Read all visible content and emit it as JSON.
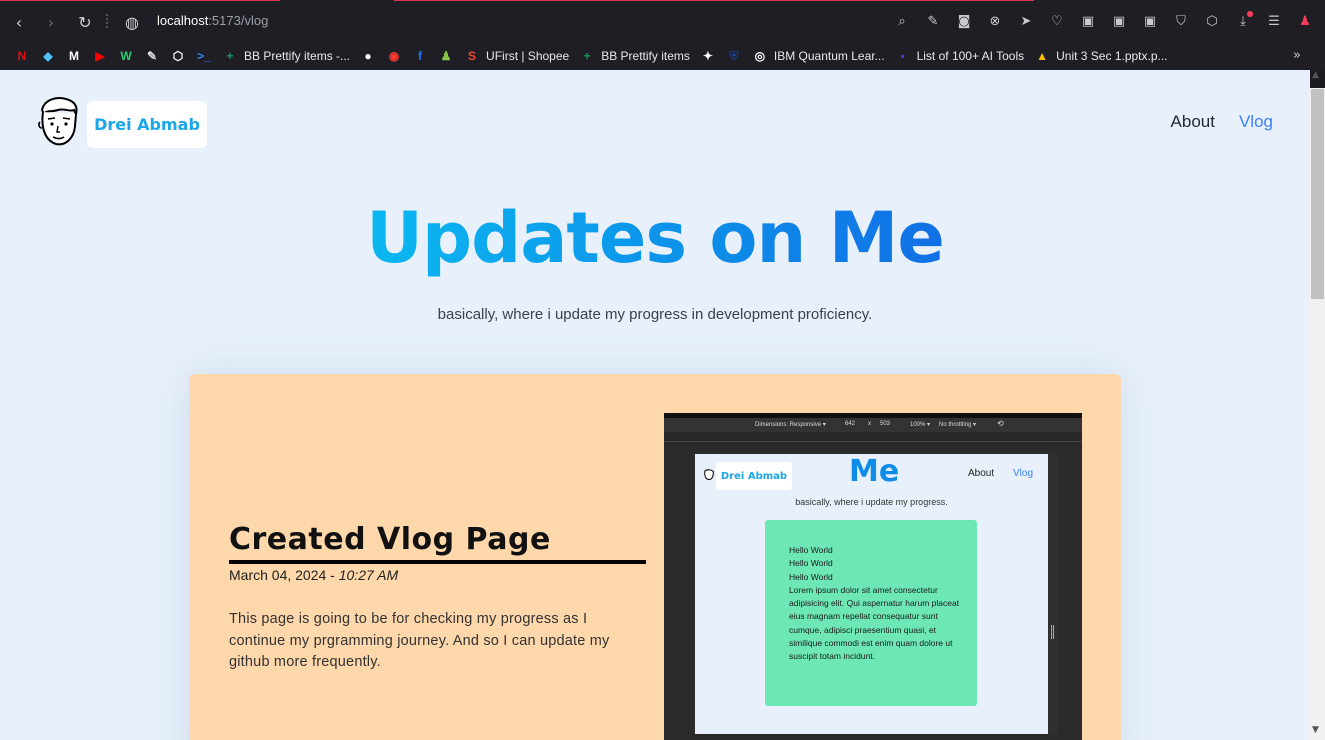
{
  "browser": {
    "url_host": "localhost",
    "url_path": ":5173/vlog",
    "toolbar_icons": [
      "zoom-icon",
      "edit-icon",
      "camera-icon",
      "block-icon",
      "send-icon",
      "heart-icon",
      "extension-icon",
      "extension-icon",
      "extension-icon",
      "shield-icon",
      "cube-icon",
      "download-icon",
      "menu-icon",
      "profile-icon"
    ],
    "bookmarks": [
      {
        "label": "",
        "color": "#e50914",
        "glyph": "N"
      },
      {
        "label": "",
        "color": "#4fc3f7",
        "glyph": "◆"
      },
      {
        "label": "",
        "color": "#ffffff",
        "glyph": "M"
      },
      {
        "label": "",
        "color": "#ff0000",
        "glyph": "▶"
      },
      {
        "label": "",
        "color": "#2ecc71",
        "glyph": "W"
      },
      {
        "label": "",
        "color": "#dddddd",
        "glyph": "✎"
      },
      {
        "label": "",
        "color": "#ffffff",
        "glyph": "⬡"
      },
      {
        "label": "",
        "color": "#3b82f6",
        "glyph": ">_"
      },
      {
        "label": "BB Prettify items -...",
        "color": "#0f9d58",
        "glyph": "+"
      },
      {
        "label": "",
        "color": "#ffffff",
        "glyph": "●"
      },
      {
        "label": "",
        "color": "#ff3b30",
        "glyph": "◉"
      },
      {
        "label": "",
        "color": "#1877f2",
        "glyph": "f"
      },
      {
        "label": "",
        "color": "#8bc34a",
        "glyph": "♟"
      },
      {
        "label": "UFirst | Shopee",
        "color": "#ee4d2d",
        "glyph": "S"
      },
      {
        "label": "BB Prettify items",
        "color": "#0f9d58",
        "glyph": "+"
      },
      {
        "label": "",
        "color": "#ffffff",
        "glyph": "✦"
      },
      {
        "label": "",
        "color": "#1e3a8a",
        "glyph": "⛨"
      },
      {
        "label": "IBM Quantum Lear...",
        "color": "#ffffff",
        "glyph": "◎"
      },
      {
        "label": "List of 100+ AI Tools",
        "color": "#6d28d9",
        "glyph": "▪"
      },
      {
        "label": "Unit 3 Sec 1.pptx.p...",
        "color": "#fbbc04",
        "glyph": "▲"
      }
    ]
  },
  "site": {
    "brand": "Drei Abmab",
    "nav": {
      "about": "About",
      "vlog": "Vlog"
    },
    "hero_title": "Updates on Me",
    "hero_subtitle": "basically, where i update my progress in development proficiency."
  },
  "post": {
    "title": "Created Vlog Page",
    "date": "March 04, 2024 - ",
    "time": "10:27 AM",
    "body": "This page is going to be for checking my progress as I continue my prgramming journey. And so I can update my github more frequently."
  },
  "screenshot": {
    "toolbar": {
      "dimensions": "Dimensions: Responsive ▾",
      "width": "642",
      "x": "x",
      "height": "503",
      "zoom": "100% ▾",
      "throttle": "No throttling ▾"
    },
    "brand": "Drei Abmab",
    "title": "Me",
    "nav_about": "About",
    "nav_vlog": "Vlog",
    "subtitle": "basically, where i update my progress.",
    "card_lines": [
      "Hello World",
      "Hello World",
      "Hello World",
      "Lorem ipsum dolor sit amet consectetur adipisicing elit. Qui aspernatur harum placeat eius magnam repellat consequatur sunt cumque, adipisci praesentium quasi, et similique commodi est enim quam dolore ut suscipit totam incidunt."
    ]
  },
  "colors": {
    "accent": "#0d8de8",
    "card_bg": "#fed7aa",
    "mini_card_bg": "#6ee7b7",
    "page_bg": "#e8f1fb"
  }
}
